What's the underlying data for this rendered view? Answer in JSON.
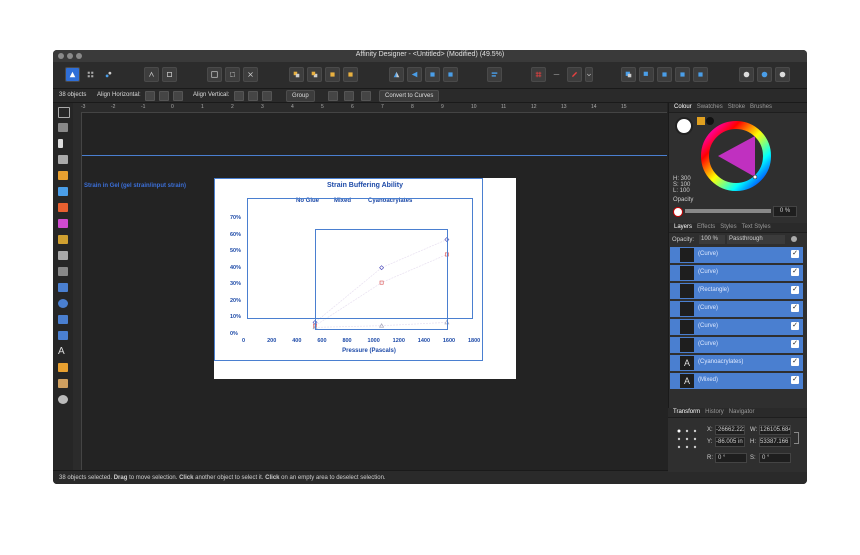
{
  "window": {
    "title": "Affinity Designer - <Untitled> (Modified) (49.5%)"
  },
  "context_bar": {
    "objects_count": "38 objects",
    "align_horizontal": "Align Horizontal:",
    "align_vertical": "Align Vertical:",
    "group_button": "Group",
    "convert_button": "Convert to Curves"
  },
  "rulers": {
    "top_ticks": [
      "-3",
      "-2",
      "-1",
      "0",
      "1",
      "2",
      "3",
      "4",
      "5",
      "6",
      "7",
      "8",
      "9",
      "10",
      "11",
      "12",
      "13",
      "14",
      "15"
    ]
  },
  "canvas": {
    "stray_text": "Strain in Gel (gel strain/input strain)"
  },
  "chart_data": {
    "type": "scatter",
    "title": "Strain Buffering Ability",
    "legend": [
      "No Glue",
      "Mixed",
      "Cyanoacrylates"
    ],
    "xlabel": "Pressure (Pascals)",
    "ylabel": "Strain in Gel (gel strain/input strain)",
    "x_ticks": [
      "0",
      "200",
      "400",
      "600",
      "800",
      "1000",
      "1200",
      "1400",
      "1600",
      "1800"
    ],
    "y_ticks": [
      "0%",
      "10%",
      "20%",
      "30%",
      "40%",
      "50%",
      "60%",
      "70%"
    ],
    "xlim": [
      0,
      1800
    ],
    "ylim": [
      0,
      70
    ],
    "series": [
      {
        "name": "No Glue",
        "x": [
          550,
          1080,
          1600
        ],
        "y": [
          7,
          40,
          57
        ],
        "color": "#3b3bb5",
        "marker": "diamond"
      },
      {
        "name": "Mixed",
        "x": [
          550,
          1080,
          1600
        ],
        "y": [
          5,
          31,
          48
        ],
        "color": "#d84a4a",
        "marker": "square"
      },
      {
        "name": "Cyanoacrylates",
        "x": [
          550,
          1080,
          1600
        ],
        "y": [
          4,
          5,
          7
        ],
        "color": "#9a9ab0",
        "marker": "triangle"
      }
    ]
  },
  "panel": {
    "color_tabs": [
      "Colour",
      "Swatches",
      "Stroke",
      "Brushes"
    ],
    "hsl": {
      "h": "H: 300",
      "s": "S: 100",
      "l": "L: 100"
    },
    "opacity_label": "Opacity",
    "opacity_value": "0 %",
    "layer_tabs": [
      "Layers",
      "Effects",
      "Styles",
      "Text Styles"
    ],
    "layer_opacity_label": "Opacity:",
    "layer_opacity_value": "100 %",
    "blend_mode": "Passthrough",
    "layers": [
      {
        "name": "(Curve)",
        "thumb": ""
      },
      {
        "name": "(Curve)",
        "thumb": ""
      },
      {
        "name": "(Rectangle)",
        "thumb": ""
      },
      {
        "name": "(Curve)",
        "thumb": ""
      },
      {
        "name": "(Curve)",
        "thumb": ""
      },
      {
        "name": "(Curve)",
        "thumb": ""
      },
      {
        "name": "(Cyanoacrylates)",
        "thumb": "A"
      },
      {
        "name": "(Mixed)",
        "thumb": "A"
      }
    ],
    "transform_tabs": [
      "Transform",
      "History",
      "Navigator"
    ],
    "transform": {
      "x_label": "X:",
      "x_value": "-26662.223",
      "y_label": "Y:",
      "y_value": "-86.005 in",
      "w_label": "W:",
      "w_value": "126105.684",
      "h_label": "H:",
      "h_value": "53387.166",
      "r_label": "R:",
      "r_value": "0 °",
      "s_label": "S:",
      "s_value": "0 °"
    }
  },
  "status": {
    "count": "38 objects selected.",
    "drag": "Drag",
    "t1": "to move selection.",
    "click1": "Click",
    "t2": "another object to select it.",
    "click2": "Click",
    "t3": "on an empty area to deselect selection."
  },
  "colors": {
    "accent": "#4a7fd0",
    "chart_text": "#1d4aa8",
    "selection": "#4a7fd0"
  }
}
